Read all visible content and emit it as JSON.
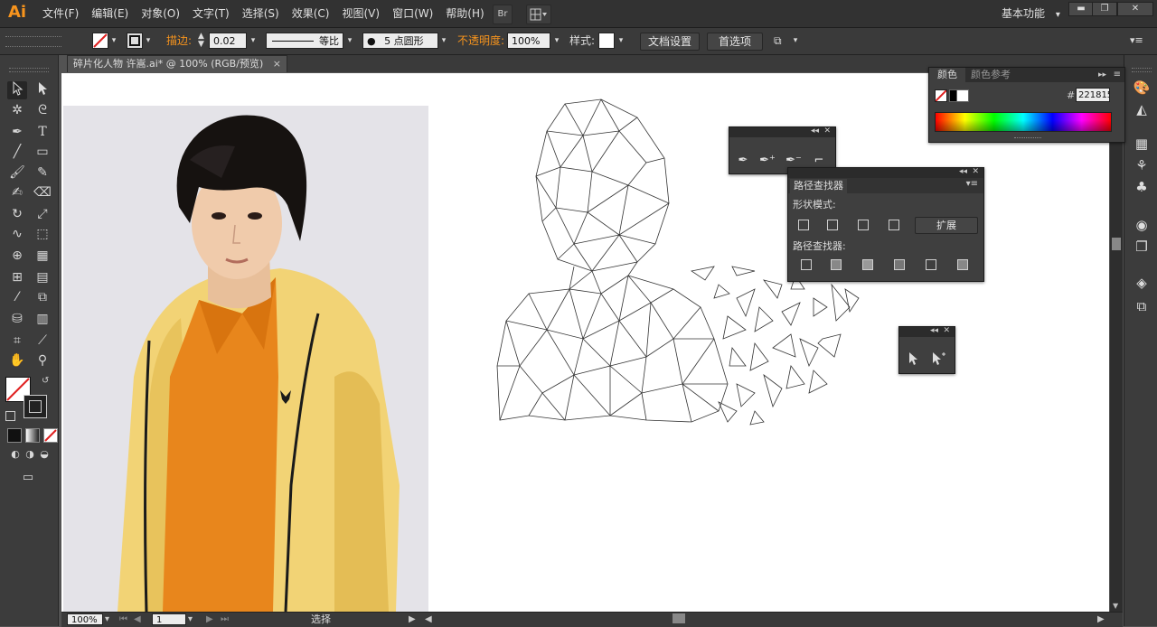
{
  "app": {
    "logo": "Ai"
  },
  "menu": [
    "文件(F)",
    "编辑(E)",
    "对象(O)",
    "文字(T)",
    "选择(S)",
    "效果(C)",
    "视图(V)",
    "窗口(W)",
    "帮助(H)"
  ],
  "menubar": {
    "bridge_label": "Br",
    "workspace": "基本功能",
    "workspace_arrow": "▾",
    "minimize": "▬",
    "restore": "❐",
    "close": "✕"
  },
  "control": {
    "stroke_label": "描边:",
    "stroke_value": "0.02 p",
    "profile_label": "等比",
    "brush_label": "5 点圆形",
    "opacity_label": "不透明度:",
    "opacity_value": "100%",
    "style_label": "样式:",
    "doc_setup": "文档设置",
    "preferences": "首选项"
  },
  "document": {
    "tab_title": "碎片化人物 许嵩.ai* @ 100% (RGB/预览)",
    "tab_close": "×"
  },
  "status": {
    "zoom": "100%",
    "page": "1",
    "tool": "选择"
  },
  "color_panel": {
    "tab_color": "颜色",
    "tab_guide": "颜色参考",
    "hex_symbol": "#",
    "hex_value": "221815",
    "spectrum": [
      "#ff0000",
      "#ffff00",
      "#00ff00",
      "#00ffff",
      "#0000ff",
      "#ff00ff",
      "#ff0000"
    ]
  },
  "pathfinder": {
    "title": "路径查找器",
    "shape_modes": "形状模式:",
    "expand": "扩展",
    "pathfinders": "路径查找器:"
  },
  "pen_panel": {
    "icons": [
      "pen-icon",
      "add-anchor-icon",
      "delete-anchor-icon",
      "convert-anchor-icon"
    ]
  },
  "select_panel": {
    "icons": [
      "selection-icon",
      "direct-select-plus-icon"
    ]
  },
  "colors": {
    "accent": "#f7941d",
    "ui_dark": "#323232",
    "panel": "#3f3f3f",
    "canvas": "#ffffff"
  }
}
